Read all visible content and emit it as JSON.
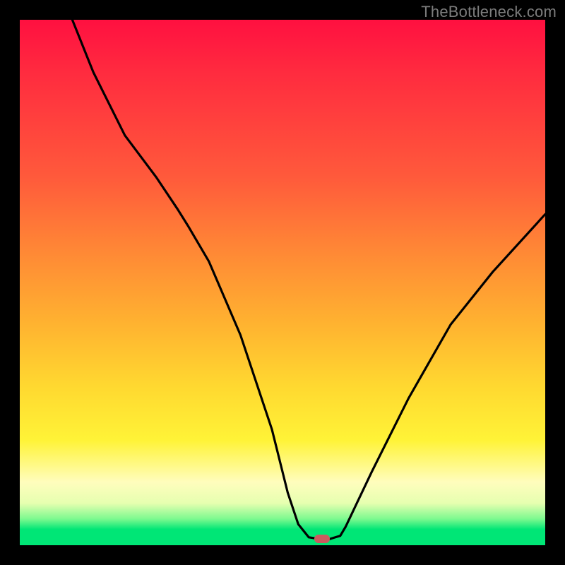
{
  "watermark": "TheBottleneck.com",
  "chart_data": {
    "type": "line",
    "title": "",
    "xlabel": "",
    "ylabel": "",
    "xlim": [
      0,
      100
    ],
    "ylim": [
      0,
      100
    ],
    "series": [
      {
        "name": "curve",
        "x": [
          10.0,
          14.0,
          20.0,
          26.0,
          30.0,
          32.0,
          36.0,
          42.0,
          48.0,
          51.0,
          53.0,
          55.0,
          57.0,
          59.0,
          61.0,
          62.0,
          67.0,
          74.0,
          82.0,
          90.0,
          100.0
        ],
        "values": [
          100.0,
          90.0,
          78.0,
          70.0,
          64.0,
          60.8,
          54.0,
          40.0,
          22.0,
          10.0,
          4.0,
          1.5,
          1.2,
          1.2,
          1.8,
          3.5,
          14.0,
          28.0,
          42.0,
          52.0,
          63.0
        ]
      }
    ],
    "marker": {
      "x": 57.5,
      "y": 1.2
    },
    "background": {
      "type": "vertical-gradient",
      "stops": [
        {
          "pos": 0,
          "color": "#ff1040"
        },
        {
          "pos": 10,
          "color": "#ff2b3f"
        },
        {
          "pos": 30,
          "color": "#ff5a3b"
        },
        {
          "pos": 45,
          "color": "#ff8b35"
        },
        {
          "pos": 58,
          "color": "#ffb330"
        },
        {
          "pos": 70,
          "color": "#ffd930"
        },
        {
          "pos": 80,
          "color": "#fff337"
        },
        {
          "pos": 88,
          "color": "#fffdbd"
        },
        {
          "pos": 92,
          "color": "#e6ffb0"
        },
        {
          "pos": 95,
          "color": "#7cf98f"
        },
        {
          "pos": 97,
          "color": "#00e676"
        },
        {
          "pos": 100,
          "color": "#00e676"
        }
      ]
    }
  },
  "colors": {
    "curve": "#000000",
    "marker": "#cc5a5f",
    "frame_bg": "#000000"
  }
}
